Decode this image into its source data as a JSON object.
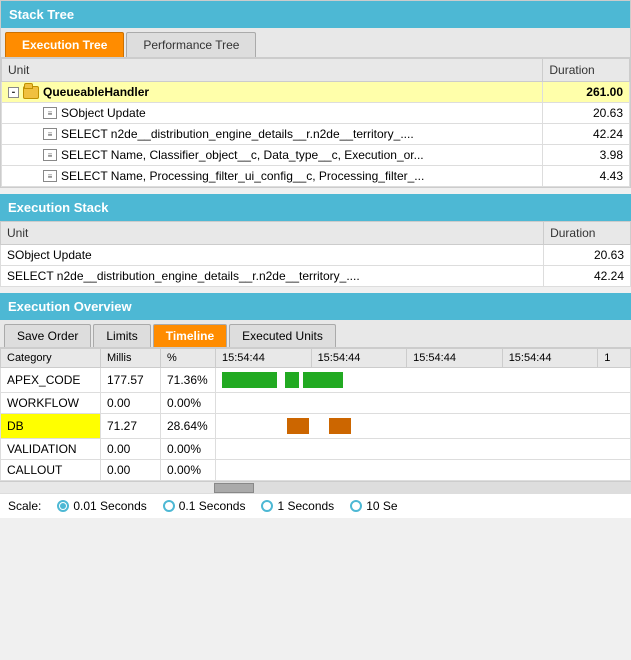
{
  "stackTree": {
    "header": "Stack Tree",
    "tabs": [
      {
        "label": "Execution Tree",
        "active": true
      },
      {
        "label": "Performance Tree",
        "active": false
      }
    ],
    "columns": {
      "unit": "Unit",
      "duration": "Duration"
    },
    "rows": [
      {
        "id": "handler",
        "indent": 0,
        "hasExpander": true,
        "hasFolder": true,
        "label": "QueueableHandler",
        "duration": "261.00",
        "highlight": true
      },
      {
        "id": "sobject",
        "indent": 1,
        "hasExpander": false,
        "hasFolder": false,
        "label": "SObject Update",
        "duration": "20.63",
        "highlight": false
      },
      {
        "id": "select1",
        "indent": 1,
        "hasExpander": false,
        "hasFolder": false,
        "label": "SELECT n2de__distribution_engine_details__r.n2de__territory_....",
        "duration": "42.24",
        "highlight": false
      },
      {
        "id": "select2",
        "indent": 1,
        "hasExpander": false,
        "hasFolder": false,
        "label": "SELECT Name, Classifier_object__c, Data_type__c, Execution_or...",
        "duration": "3.98",
        "highlight": false
      },
      {
        "id": "select3",
        "indent": 1,
        "hasExpander": false,
        "hasFolder": false,
        "label": "SELECT Name, Processing_filter_ui_config__c, Processing_filter_...",
        "duration": "4.43",
        "highlight": false
      }
    ]
  },
  "executionStack": {
    "header": "Execution Stack",
    "columns": {
      "unit": "Unit",
      "duration": "Duration"
    },
    "rows": [
      {
        "label": "SObject Update",
        "duration": "20.63"
      },
      {
        "label": "SELECT n2de__distribution_engine_details__r.n2de__territory_....",
        "duration": "42.24"
      }
    ]
  },
  "executionOverview": {
    "header": "Execution Overview",
    "tabs": [
      {
        "label": "Save Order",
        "active": false
      },
      {
        "label": "Limits",
        "active": false
      },
      {
        "label": "Timeline",
        "active": true
      },
      {
        "label": "Executed Units",
        "active": false
      }
    ],
    "tableHeaders": {
      "category": "Category",
      "millis": "Millis",
      "percent": "%",
      "times": [
        "15:54:44",
        "15:54:44",
        "15:54:44",
        "15:54:44",
        "1"
      ]
    },
    "rows": [
      {
        "category": "APEX_CODE",
        "millis": "177.57",
        "percent": "71.36%",
        "bars": [
          {
            "color": "green",
            "width": 55,
            "offset": 0
          },
          {
            "color": "green",
            "width": 15,
            "offset": 60
          },
          {
            "color": "green",
            "width": 35,
            "offset": 80
          }
        ],
        "highlight": false
      },
      {
        "category": "WORKFLOW",
        "millis": "0.00",
        "percent": "0.00%",
        "bars": [],
        "highlight": false
      },
      {
        "category": "DB",
        "millis": "71.27",
        "percent": "28.64%",
        "bars": [
          {
            "color": "orange",
            "width": 22,
            "offset": 60
          },
          {
            "color": "orange",
            "width": 22,
            "offset": 90
          }
        ],
        "highlight": true
      },
      {
        "category": "VALIDATION",
        "millis": "0.00",
        "percent": "0.00%",
        "bars": [],
        "highlight": false
      },
      {
        "category": "CALLOUT",
        "millis": "0.00",
        "percent": "0.00%",
        "bars": [],
        "highlight": false
      }
    ],
    "scale": {
      "label": "Scale:",
      "options": [
        {
          "value": "0.01",
          "label": "0.01 Seconds",
          "selected": true
        },
        {
          "value": "0.1",
          "label": "0.1 Seconds",
          "selected": false
        },
        {
          "value": "1",
          "label": "1 Seconds",
          "selected": false
        },
        {
          "value": "10",
          "label": "10 Se",
          "selected": false
        }
      ]
    }
  }
}
